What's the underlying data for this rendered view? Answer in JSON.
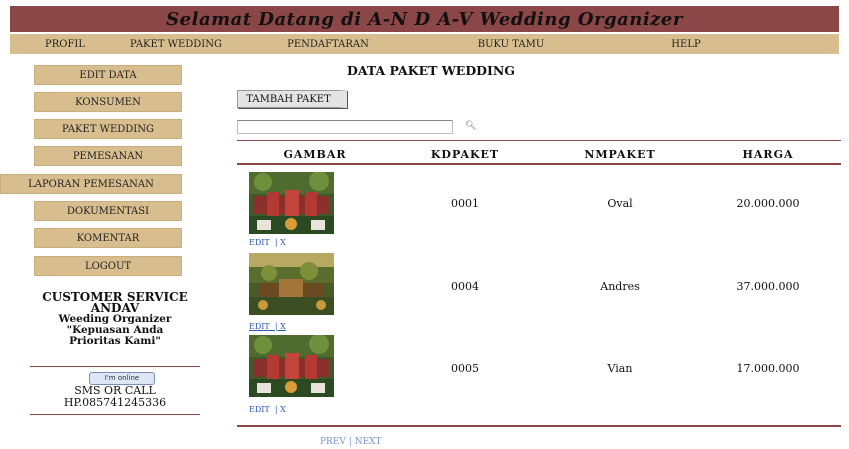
{
  "header": {
    "banner_title": "Selamat Datang di A-N D A-V Wedding Organizer"
  },
  "topnav": {
    "items": [
      {
        "label": "PROFIL"
      },
      {
        "label": "PAKET WEDDING"
      },
      {
        "label": "PENDAFTARAN"
      },
      {
        "label": "BUKU TAMU"
      },
      {
        "label": "HELP"
      }
    ]
  },
  "sidebar": {
    "items": [
      {
        "label": "EDIT DATA"
      },
      {
        "label": "KONSUMEN"
      },
      {
        "label": "PAKET WEDDING"
      },
      {
        "label": "PEMESANAN"
      },
      {
        "label": "LAPORAN PEMESANAN"
      },
      {
        "label": "DOKUMENTASI"
      },
      {
        "label": "KOMENTAR"
      },
      {
        "label": "LOGOUT"
      }
    ],
    "cs": {
      "title": "CUSTOMER SERVICE",
      "name": "ANDAV",
      "line1": "Weeding Organizer",
      "line2": "\"Kepuasan Anda",
      "line3": "Prioritas Kami\""
    },
    "online_badge": "I'm online",
    "sms": "SMS OR CALL",
    "phone": "HP.085741245336"
  },
  "main": {
    "title": "DATA PAKET WEDDING",
    "add_button": "TAMBAH PAKET",
    "search": {
      "value": "",
      "icon": "search-icon"
    },
    "columns": [
      "GAMBAR",
      "KDPAKET",
      "NMPAKET",
      "HARGA"
    ],
    "rows": [
      {
        "kdpaket": "0001",
        "nmpaket": "Oval",
        "harga": "20.000.000",
        "edit": "EDIT",
        "delete": "X"
      },
      {
        "kdpaket": "0004",
        "nmpaket": "Andres",
        "harga": "37.000.000",
        "edit": "EDIT",
        "delete": "X"
      },
      {
        "kdpaket": "0005",
        "nmpaket": "Vian",
        "harga": "17.000.000",
        "edit": "EDIT",
        "delete": "X"
      }
    ],
    "pager": {
      "prev": "PREV",
      "separator": "|",
      "next": "NEXT"
    }
  },
  "colors": {
    "banner": "#8b4747",
    "nav": "#d8bd8e",
    "link": "#2e56b0",
    "rule": "#8b4747"
  }
}
